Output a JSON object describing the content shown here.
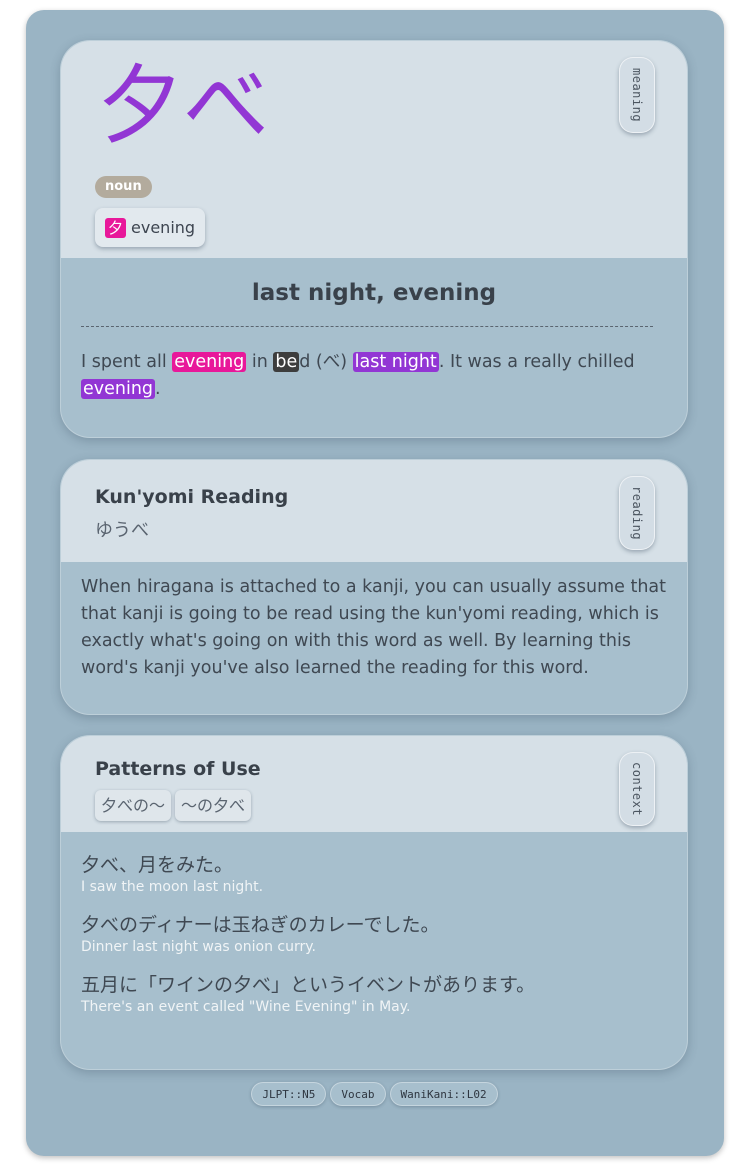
{
  "meaning_card": {
    "vocab": "夕べ",
    "part_of_speech": "noun",
    "component_kanji": "夕",
    "component_meaning": "evening",
    "side_tab": "meaning",
    "meaning": "last night, evening",
    "mnemonic": {
      "t1": "I spent all ",
      "h1": "evening",
      "t2": " in ",
      "h2": "be",
      "t3": "d (べ) ",
      "h3": "last night",
      "t4": ". It was a really chilled ",
      "h4": "evening",
      "t5": "."
    }
  },
  "reading_card": {
    "title": "Kun'yomi Reading",
    "reading": "ゆうべ",
    "side_tab": "reading",
    "explanation": "When hiragana is attached to a kanji, you can usually assume that that kanji is going to be read using the kun'yomi reading, which is exactly what's going on with this word as well. By learning this word's kanji you've also learned the reading for this word."
  },
  "context_card": {
    "title": "Patterns of Use",
    "patterns": [
      "夕べの〜",
      "〜の夕べ"
    ],
    "side_tab": "context",
    "sentences": [
      {
        "jp": "夕べ、月をみた。",
        "en": "I saw the moon last night."
      },
      {
        "jp": "夕べのディナーは玉ねぎのカレーでした。",
        "en": "Dinner last night was onion curry."
      },
      {
        "jp": "五月に「ワインの夕べ」というイベントがあります。",
        "en": "There's an event called \"Wine Evening\" in May."
      }
    ]
  },
  "tags": [
    "JLPT::N5",
    "Vocab",
    "WaniKani::L02"
  ],
  "colors": {
    "vocab": "#9236d4",
    "kanji_highlight": "#e8189a",
    "vocab_highlight": "#9236d4",
    "background": "#9ab4c4"
  }
}
